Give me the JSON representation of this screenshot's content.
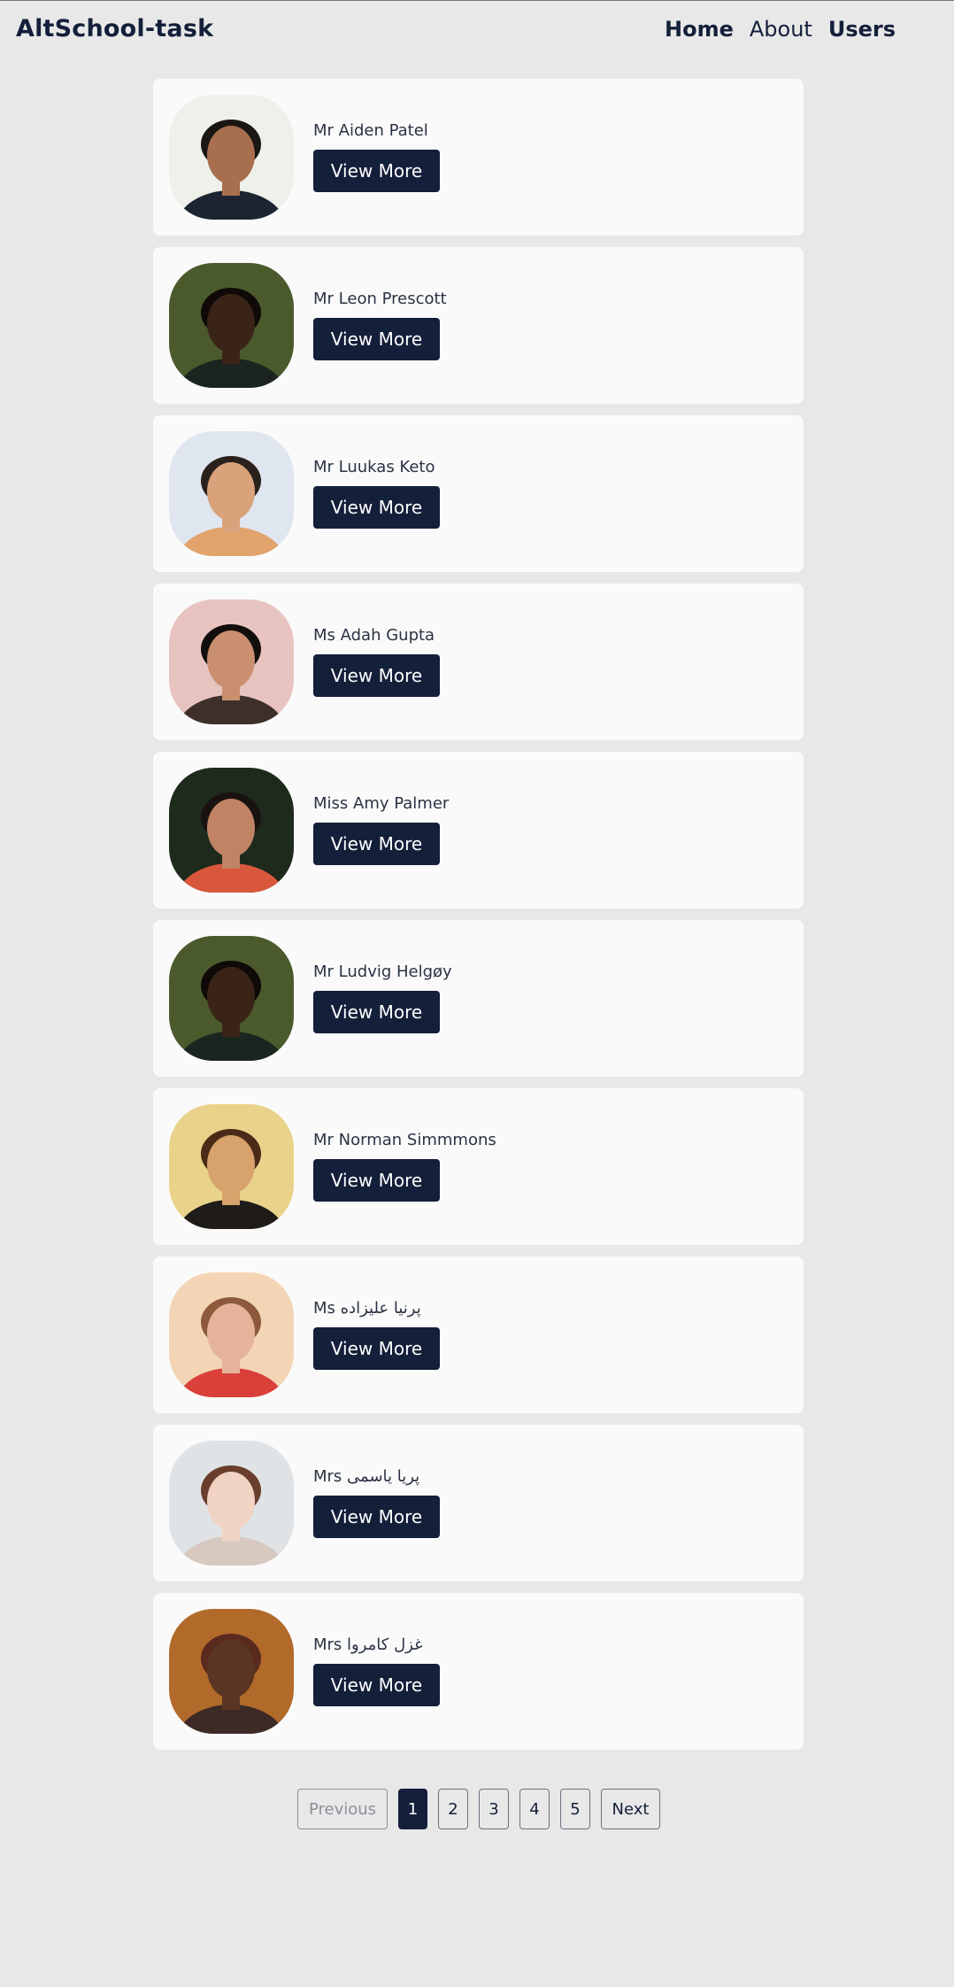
{
  "header": {
    "brand": "AltSchool-task",
    "nav": [
      {
        "label": "Home",
        "weight": "bold"
      },
      {
        "label": "About",
        "weight": "regular"
      },
      {
        "label": "Users",
        "weight": "bold"
      }
    ]
  },
  "users": [
    {
      "name": "Mr Aiden Patel",
      "button": "View More",
      "avatar_icon": "user-photo",
      "bg": "#eef0ea",
      "skin": "#a86f4e",
      "hair": "#1a1614",
      "shirt": "#1b2430"
    },
    {
      "name": "Mr Leon Prescott",
      "button": "View More",
      "avatar_icon": "user-photo",
      "bg": "#4b5a2c",
      "skin": "#3a2417",
      "hair": "#0f0a07",
      "shirt": "#1c2420"
    },
    {
      "name": "Mr Luukas Keto",
      "button": "View More",
      "avatar_icon": "user-photo",
      "bg": "#dfe6f0",
      "skin": "#d9a27a",
      "hair": "#2a211c",
      "shirt": "#e1a36b"
    },
    {
      "name": "Ms Adah Gupta",
      "button": "View More",
      "avatar_icon": "user-photo",
      "bg": "#e8c4c0",
      "skin": "#c98f6e",
      "hair": "#120e0c",
      "shirt": "#3e2f2b"
    },
    {
      "name": "Miss Amy Palmer",
      "button": "View More",
      "avatar_icon": "user-photo",
      "bg": "#1d2a1c",
      "skin": "#c08366",
      "hair": "#1a1210",
      "shirt": "#d9573d"
    },
    {
      "name": "Mr Ludvig Helgøy",
      "button": "View More",
      "avatar_icon": "user-photo",
      "bg": "#4b5a2c",
      "skin": "#3a2417",
      "hair": "#0f0a07",
      "shirt": "#1c2420"
    },
    {
      "name": "Mr Norman Simmmons",
      "button": "View More",
      "avatar_icon": "user-photo",
      "bg": "#e9d38a",
      "skin": "#d7a26b",
      "hair": "#4a2b18",
      "shirt": "#1e1b19"
    },
    {
      "name": "Ms پرنیا علیزاده",
      "button": "View More",
      "avatar_icon": "user-photo",
      "bg": "#f3d5b5",
      "skin": "#e4b39a",
      "hair": "#8c5a3a",
      "shirt": "#d9403a"
    },
    {
      "name": "Mrs پریا یاسمی",
      "button": "View More",
      "avatar_icon": "user-photo",
      "bg": "#dfe3e6",
      "skin": "#f0d3c3",
      "hair": "#6a3e2c",
      "shirt": "#d7c9c0"
    },
    {
      "name": "Mrs غزل کامروا",
      "button": "View More",
      "avatar_icon": "user-photo",
      "bg": "#b26a2a",
      "skin": "#5a3523",
      "hair": "#5a2a1f",
      "shirt": "#3d2a26"
    }
  ],
  "pagination": {
    "previous": "Previous",
    "pages": [
      "1",
      "2",
      "3",
      "4",
      "5"
    ],
    "current": "1",
    "next": "Next"
  }
}
